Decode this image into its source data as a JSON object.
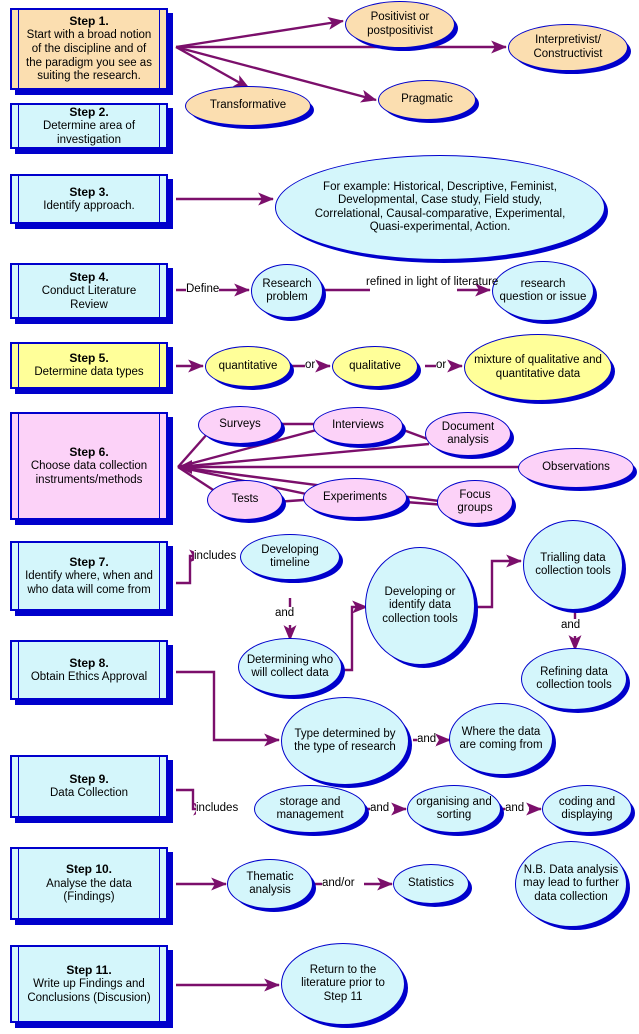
{
  "diagram": {
    "title": "Research Process Flowchart - 11 Steps",
    "colors": {
      "box_border": "#0000cc",
      "arrow": "#7b0f6b",
      "fill_peach": "#fbdeb0",
      "fill_cyan": "#d4f6fb",
      "fill_yellow": "#ffff99",
      "fill_pink": "#fcd2f8"
    }
  },
  "steps": [
    {
      "id": "step1",
      "title": "Step 1.",
      "body": "Start with a broad notion of the discipline and of the paradigm you see as suiting the research.",
      "color": "peach"
    },
    {
      "id": "step2",
      "title": "Step 2.",
      "body": "Determine area of investigation",
      "color": "cyan"
    },
    {
      "id": "step3",
      "title": "Step 3.",
      "body": "Identify approach.",
      "color": "cyan"
    },
    {
      "id": "step4",
      "title": "Step 4.",
      "body": "Conduct Literature Review",
      "color": "cyan"
    },
    {
      "id": "step5",
      "title": "Step 5.",
      "body": "Determine data types",
      "color": "yellow"
    },
    {
      "id": "step6",
      "title": "Step 6.",
      "body": "Choose data collection instruments/methods",
      "color": "pink"
    },
    {
      "id": "step7",
      "title": "Step 7.",
      "body": "Identify where, when and who data will come from",
      "color": "cyan"
    },
    {
      "id": "step8",
      "title": "Step 8.",
      "body": "Obtain Ethics Approval",
      "color": "cyan"
    },
    {
      "id": "step9",
      "title": "Step 9.",
      "body": "Data Collection",
      "color": "cyan"
    },
    {
      "id": "step10",
      "title": "Step 10.",
      "body": "Analyse the data (Findings)",
      "color": "cyan"
    },
    {
      "id": "step11",
      "title": "Step 11.",
      "body": "Write up Findings and Conclusions (Discusion)",
      "color": "cyan"
    }
  ],
  "nodes": {
    "positivist": "Positivist or postpositivist",
    "interpretivist": "Interpretivist/ Constructivist",
    "transformative": "Transformative",
    "pragmatic": "Pragmatic",
    "approaches": "For example: Historical, Descriptive, Feminist, Developmental, Case study, Field study, Correlational, Causal-comparative, Experimental, Quasi-experimental, Action.",
    "research_problem": "Research problem",
    "research_question": "research question or issue",
    "quantitative": "quantitative",
    "qualitative": "qualitative",
    "mixture": "mixture of qualitative and quantitative data",
    "surveys": "Surveys",
    "interviews": "Interviews",
    "document_analysis": "Document analysis",
    "observations": "Observations",
    "tests": "Tests",
    "experiments": "Experiments",
    "focus_groups": "Focus groups",
    "developing_timeline": "Developing timeline",
    "determining_who": "Determining who will collect data",
    "developing_tools": "Developing or identify data collection tools",
    "trialling_tools": "Trialling data collection tools",
    "refining_tools": "Refining data collection tools",
    "type_determined": "Type determined by the type  of research",
    "where_data": "Where the data are coming from",
    "storage": "storage and management",
    "organising": "organising and sorting",
    "coding": "coding and displaying",
    "thematic": "Thematic analysis",
    "statistics": "Statistics",
    "nb_note": "N.B. Data analysis may lead to further data collection",
    "return_literature": "Return to the literature prior to Step 11"
  },
  "edge_labels": {
    "define": "Define",
    "refined": "refined in light of literature",
    "or1": "or",
    "or2": "or",
    "includes7": "includes",
    "and_timeline": "and",
    "and_trialling": "and",
    "and_type": "and",
    "includes9": "includes",
    "and_storage": "and",
    "and_organising": "and",
    "and_or": "and/or"
  }
}
